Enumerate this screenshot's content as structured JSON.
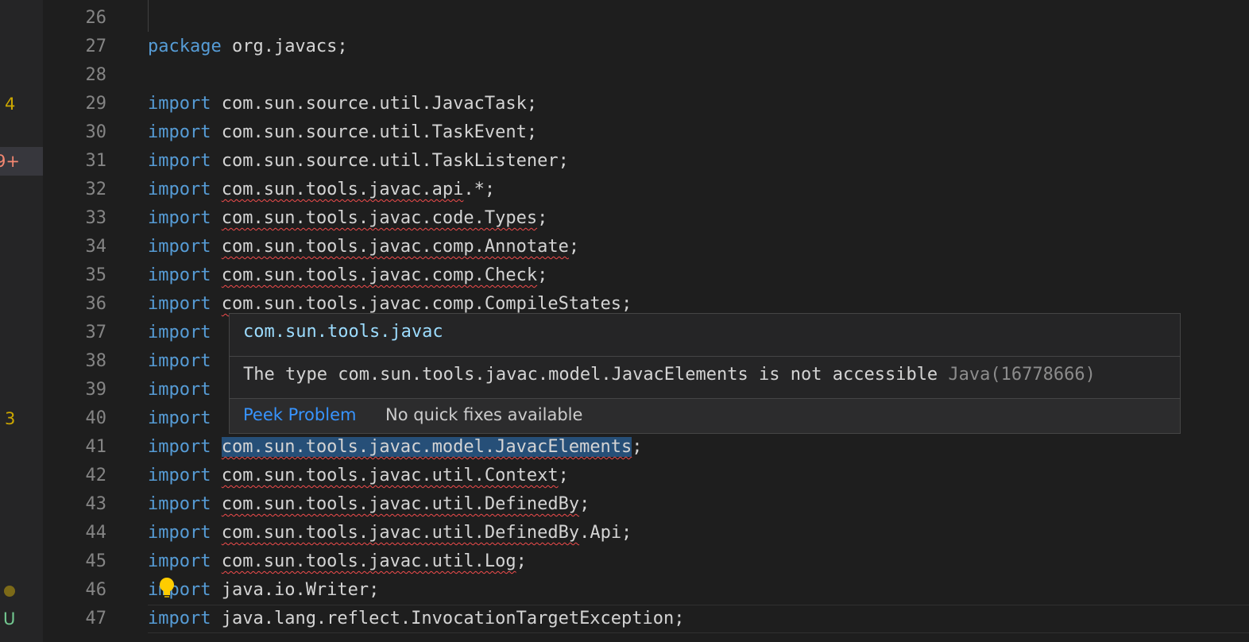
{
  "activity_badges": [
    {
      "id": "badge-4",
      "text": "4",
      "line_index": 3,
      "kind": "warn"
    },
    {
      "id": "badge-9plus",
      "text": "9+",
      "line_index": 5,
      "kind": "err"
    },
    {
      "id": "badge-3",
      "text": "3",
      "line_index": 14,
      "kind": "warn"
    },
    {
      "id": "badge-dot",
      "text": "",
      "line_index": 20,
      "kind": "dot"
    },
    {
      "id": "badge-u",
      "text": "U",
      "line_index": 21,
      "kind": "untracked"
    }
  ],
  "first_line_number": 26,
  "lines": [
    {
      "no": "26",
      "kw": "",
      "rest": "",
      "squiggle": ""
    },
    {
      "no": "27",
      "kw": "package",
      "rest": " org.javacs;",
      "squiggle": ""
    },
    {
      "no": "28",
      "kw": "",
      "rest": "",
      "squiggle": ""
    },
    {
      "no": "29",
      "kw": "import",
      "rest": " com.sun.source.util.JavacTask;",
      "squiggle": ""
    },
    {
      "no": "30",
      "kw": "import",
      "rest": " com.sun.source.util.TaskEvent;",
      "squiggle": ""
    },
    {
      "no": "31",
      "kw": "import",
      "rest": " com.sun.source.util.TaskListener;",
      "squiggle": ""
    },
    {
      "no": "32",
      "kw": "import",
      "rest": ".*;",
      "squiggle": "com.sun.tools.javac.api"
    },
    {
      "no": "33",
      "kw": "import",
      "rest": ";",
      "squiggle": "com.sun.tools.javac.code.Types"
    },
    {
      "no": "34",
      "kw": "import",
      "rest": ";",
      "squiggle": "com.sun.tools.javac.comp.Annotate"
    },
    {
      "no": "35",
      "kw": "import",
      "rest": ";",
      "squiggle": "com.sun.tools.javac.comp.Check"
    },
    {
      "no": "36",
      "kw": "import",
      "rest": ";",
      "squiggle": "com.sun.tools.javac.comp.CompileStates"
    },
    {
      "no": "37",
      "kw": "import",
      "rest": "",
      "squiggle": ""
    },
    {
      "no": "38",
      "kw": "import",
      "rest": "",
      "squiggle": ""
    },
    {
      "no": "39",
      "kw": "import",
      "rest": "",
      "squiggle": ""
    },
    {
      "no": "40",
      "kw": "import",
      "rest": "",
      "squiggle": ""
    },
    {
      "no": "41",
      "kw": "import",
      "rest": ";",
      "squiggle": "com.sun.tools.javac.model.JavacElements"
    },
    {
      "no": "42",
      "kw": "import",
      "rest": ";",
      "squiggle": "com.sun.tools.javac.util.Context"
    },
    {
      "no": "43",
      "kw": "import",
      "rest": ";",
      "squiggle": "com.sun.tools.javac.util.DefinedBy"
    },
    {
      "no": "44",
      "kw": "import",
      "rest": ".Api;",
      "squiggle": "com.sun.tools.javac.util.DefinedBy"
    },
    {
      "no": "45",
      "kw": "import",
      "rest": ";",
      "squiggle": "com.sun.tools.javac.util.Log"
    },
    {
      "no": "46",
      "kw": "import",
      "rest": " java.io.Writer;",
      "squiggle": ""
    },
    {
      "no": "47",
      "kw": "import",
      "rest": " java.lang.reflect.InvocationTargetException;",
      "squiggle": ""
    }
  ],
  "hover": {
    "title": "com.sun.tools.javac",
    "message": "The type com.sun.tools.javac.model.JavacElements is not accessible ",
    "code": "Java(16778666)",
    "peek_label": "Peek Problem",
    "no_fix_label": "No quick fixes available"
  },
  "icons": {
    "bulb": "lightbulb-icon"
  },
  "colors": {
    "keyword": "#569cd6",
    "error": "#f14c4c",
    "warning": "#cca700",
    "link": "#3794ff"
  }
}
